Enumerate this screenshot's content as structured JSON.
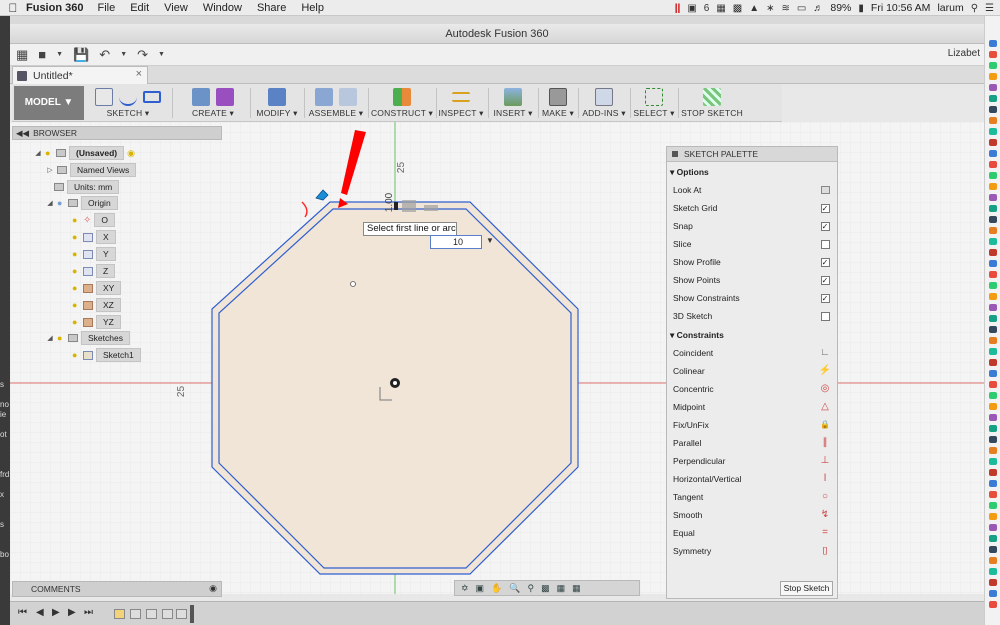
{
  "menubar": {
    "apple": "",
    "app_name": "Fusion 360",
    "menus": [
      "File",
      "Edit",
      "View",
      "Window",
      "Share",
      "Help"
    ],
    "status": {
      "badge": "6",
      "battery": "89%",
      "clock": "Fri 10:56 AM",
      "user": "larum"
    }
  },
  "window": {
    "title": "Autodesk Fusion 360",
    "user_short": "Lizabet",
    "tab_label": "Untitled*",
    "tab_close": "×"
  },
  "toolbar": {
    "workspace": "MODEL ▼",
    "groups": [
      {
        "label": "SKETCH ▾"
      },
      {
        "label": "CREATE ▾"
      },
      {
        "label": "MODIFY ▾"
      },
      {
        "label": "ASSEMBLE ▾"
      },
      {
        "label": "CONSTRUCT ▾"
      },
      {
        "label": "INSPECT ▾"
      },
      {
        "label": "INSERT ▾"
      },
      {
        "label": "MAKE ▾"
      },
      {
        "label": "ADD-INS ▾"
      },
      {
        "label": "SELECT ▾"
      },
      {
        "label": "STOP SKETCH"
      }
    ]
  },
  "browser": {
    "title": "BROWSER",
    "nodes": [
      {
        "label": "(Unsaved)"
      },
      {
        "label": "Named Views"
      },
      {
        "label": "Units: mm"
      },
      {
        "label": "Origin"
      },
      {
        "label": "O"
      },
      {
        "label": "X"
      },
      {
        "label": "Y"
      },
      {
        "label": "Z"
      },
      {
        "label": "XY"
      },
      {
        "label": "XZ"
      },
      {
        "label": "YZ"
      },
      {
        "label": "Sketches"
      },
      {
        "label": "Sketch1"
      }
    ]
  },
  "canvas": {
    "tooltip": "Select first line or arc",
    "dim_value": "10",
    "dim_label_top": "25",
    "dim_label_left": "25",
    "dim_label_small": "1.00"
  },
  "palette": {
    "title": "SKETCH PALETTE",
    "options_title": "Options",
    "options": [
      {
        "label": "Look At",
        "kind": "icon"
      },
      {
        "label": "Sketch Grid",
        "checked": true
      },
      {
        "label": "Snap",
        "checked": true
      },
      {
        "label": "Slice",
        "checked": false
      },
      {
        "label": "Show Profile",
        "checked": true
      },
      {
        "label": "Show Points",
        "checked": true
      },
      {
        "label": "Show Constraints",
        "checked": true
      },
      {
        "label": "3D Sketch",
        "checked": false
      }
    ],
    "constraints_title": "Constraints",
    "constraints": [
      {
        "label": "Coincident",
        "icon": "∟"
      },
      {
        "label": "Colinear",
        "icon": "⚡"
      },
      {
        "label": "Concentric",
        "icon": "◎"
      },
      {
        "label": "Midpoint",
        "icon": "△"
      },
      {
        "label": "Fix/UnFix",
        "icon": "🔒"
      },
      {
        "label": "Parallel",
        "icon": "∥"
      },
      {
        "label": "Perpendicular",
        "icon": "⊥"
      },
      {
        "label": "Horizontal/Vertical",
        "icon": "ǀ"
      },
      {
        "label": "Tangent",
        "icon": "○"
      },
      {
        "label": "Smooth",
        "icon": "↯"
      },
      {
        "label": "Equal",
        "icon": "="
      },
      {
        "label": "Symmetry",
        "icon": "[]"
      }
    ],
    "stop_button": "Stop Sketch"
  },
  "comments": {
    "label": "COMMENTS"
  },
  "colors": {
    "sketch_line": "#2f5fcf",
    "profile_fill": "#f1e5d8",
    "x_axis": "#d94a4a",
    "y_axis": "#46b446",
    "arrow": "#ff0000",
    "cursor": "#1a8fd8"
  }
}
